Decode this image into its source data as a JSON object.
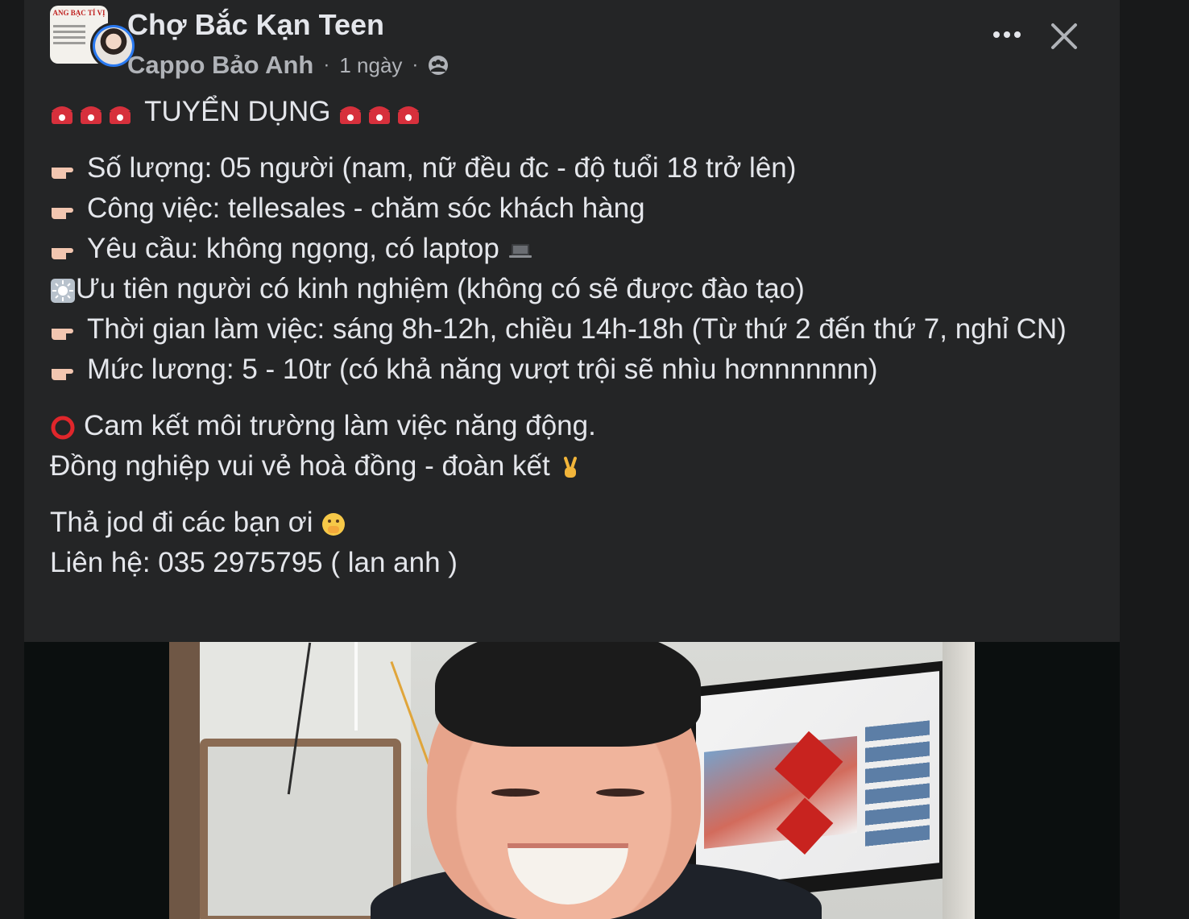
{
  "group": {
    "name": "Chợ Bắc Kạn Teen",
    "avatar_text": "ANG BẠC TÍ VỊ",
    "avatar_icon": "group-logo-icon"
  },
  "post_meta": {
    "author": "Cappo Bảo Anh",
    "separator": "·",
    "time": "1 ngày",
    "audience_icon": "group-audience-icon"
  },
  "actions": {
    "more_icon": "more-options-icon",
    "close_icon": "close-icon"
  },
  "post": {
    "headline": "TUYỂN DỤNG",
    "lines": [
      "Số lượng: 05 người (nam, nữ đều đc - độ tuổi 18 trở lên)",
      "Công việc: tellesales - chăm sóc khách hàng",
      "Yêu cầu: không ngọng, có laptop",
      "Ưu tiên người có kinh nghiệm (không có sẽ được đào tạo)",
      "Thời gian làm việc: sáng 8h-12h, chiều 14h-18h (Từ thứ 2 đến thứ 7, nghỉ CN)",
      "Mức lương: 5 - 10tr (có khả năng vượt trội sẽ nhìu hơnnnnnnn)"
    ],
    "commit_line": "Cam kết môi trường làm việc năng động.",
    "colleague_line": "Đồng nghiệp vui vẻ hoà đồng - đoàn kết",
    "cta_line": "Thả jod đi các bạn ơi",
    "contact_line": "Liên hệ: 035 2975795 ( lan anh )"
  },
  "colors": {
    "background": "#18191a",
    "card": "#242526",
    "primary_text": "#e4e6eb",
    "secondary_text": "#b0b3b8",
    "avatar_ring": "#2a79f0"
  }
}
